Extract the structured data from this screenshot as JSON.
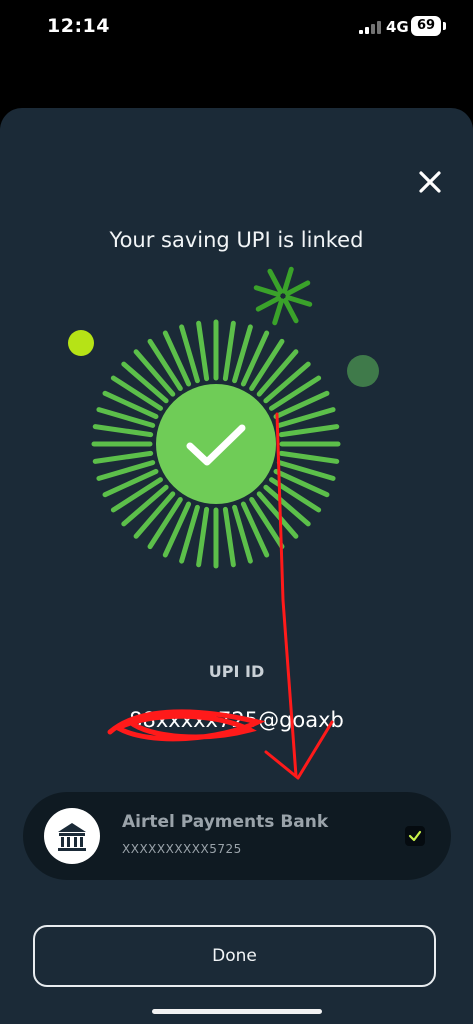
{
  "status_bar": {
    "time": "12:14",
    "network": "4G",
    "battery": "69"
  },
  "dialog": {
    "headline": "Your saving UPI is linked",
    "upi_label": "UPI ID",
    "upi_id": "88xxxxx725@goaxb"
  },
  "bank": {
    "name": "Airtel Payments Bank",
    "account": "XXXXXXXXXX5725",
    "selected": true
  },
  "actions": {
    "done_label": "Done"
  },
  "colors": {
    "sheet_bg": "#1b2a37",
    "burst_green": "#5cbf4a",
    "badge_green": "#6fcc57",
    "dot_lime": "#b6e316",
    "dot_muted_green": "#3f7a4a",
    "annotation_red": "#ff1a1a"
  }
}
